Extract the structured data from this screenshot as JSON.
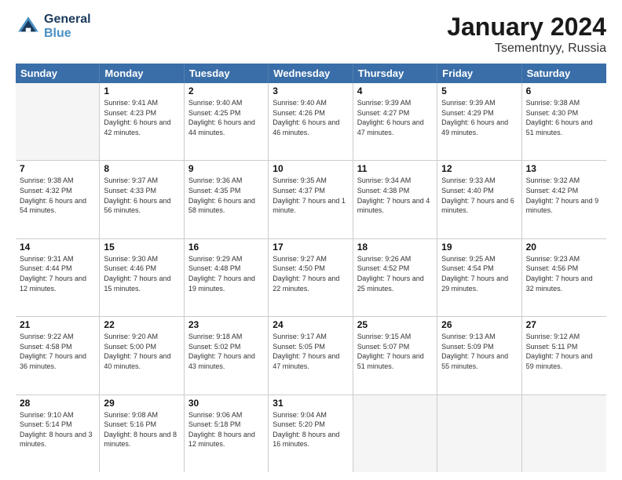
{
  "header": {
    "logo_line1": "General",
    "logo_line2": "Blue",
    "month_title": "January 2024",
    "location": "Tsementnyy, Russia"
  },
  "days_of_week": [
    "Sunday",
    "Monday",
    "Tuesday",
    "Wednesday",
    "Thursday",
    "Friday",
    "Saturday"
  ],
  "weeks": [
    [
      {
        "day": "",
        "empty": true
      },
      {
        "day": "1",
        "sunrise": "Sunrise: 9:41 AM",
        "sunset": "Sunset: 4:23 PM",
        "daylight": "Daylight: 6 hours and 42 minutes."
      },
      {
        "day": "2",
        "sunrise": "Sunrise: 9:40 AM",
        "sunset": "Sunset: 4:25 PM",
        "daylight": "Daylight: 6 hours and 44 minutes."
      },
      {
        "day": "3",
        "sunrise": "Sunrise: 9:40 AM",
        "sunset": "Sunset: 4:26 PM",
        "daylight": "Daylight: 6 hours and 46 minutes."
      },
      {
        "day": "4",
        "sunrise": "Sunrise: 9:39 AM",
        "sunset": "Sunset: 4:27 PM",
        "daylight": "Daylight: 6 hours and 47 minutes."
      },
      {
        "day": "5",
        "sunrise": "Sunrise: 9:39 AM",
        "sunset": "Sunset: 4:29 PM",
        "daylight": "Daylight: 6 hours and 49 minutes."
      },
      {
        "day": "6",
        "sunrise": "Sunrise: 9:38 AM",
        "sunset": "Sunset: 4:30 PM",
        "daylight": "Daylight: 6 hours and 51 minutes."
      }
    ],
    [
      {
        "day": "7",
        "sunrise": "Sunrise: 9:38 AM",
        "sunset": "Sunset: 4:32 PM",
        "daylight": "Daylight: 6 hours and 54 minutes."
      },
      {
        "day": "8",
        "sunrise": "Sunrise: 9:37 AM",
        "sunset": "Sunset: 4:33 PM",
        "daylight": "Daylight: 6 hours and 56 minutes."
      },
      {
        "day": "9",
        "sunrise": "Sunrise: 9:36 AM",
        "sunset": "Sunset: 4:35 PM",
        "daylight": "Daylight: 6 hours and 58 minutes."
      },
      {
        "day": "10",
        "sunrise": "Sunrise: 9:35 AM",
        "sunset": "Sunset: 4:37 PM",
        "daylight": "Daylight: 7 hours and 1 minute."
      },
      {
        "day": "11",
        "sunrise": "Sunrise: 9:34 AM",
        "sunset": "Sunset: 4:38 PM",
        "daylight": "Daylight: 7 hours and 4 minutes."
      },
      {
        "day": "12",
        "sunrise": "Sunrise: 9:33 AM",
        "sunset": "Sunset: 4:40 PM",
        "daylight": "Daylight: 7 hours and 6 minutes."
      },
      {
        "day": "13",
        "sunrise": "Sunrise: 9:32 AM",
        "sunset": "Sunset: 4:42 PM",
        "daylight": "Daylight: 7 hours and 9 minutes."
      }
    ],
    [
      {
        "day": "14",
        "sunrise": "Sunrise: 9:31 AM",
        "sunset": "Sunset: 4:44 PM",
        "daylight": "Daylight: 7 hours and 12 minutes."
      },
      {
        "day": "15",
        "sunrise": "Sunrise: 9:30 AM",
        "sunset": "Sunset: 4:46 PM",
        "daylight": "Daylight: 7 hours and 15 minutes."
      },
      {
        "day": "16",
        "sunrise": "Sunrise: 9:29 AM",
        "sunset": "Sunset: 4:48 PM",
        "daylight": "Daylight: 7 hours and 19 minutes."
      },
      {
        "day": "17",
        "sunrise": "Sunrise: 9:27 AM",
        "sunset": "Sunset: 4:50 PM",
        "daylight": "Daylight: 7 hours and 22 minutes."
      },
      {
        "day": "18",
        "sunrise": "Sunrise: 9:26 AM",
        "sunset": "Sunset: 4:52 PM",
        "daylight": "Daylight: 7 hours and 25 minutes."
      },
      {
        "day": "19",
        "sunrise": "Sunrise: 9:25 AM",
        "sunset": "Sunset: 4:54 PM",
        "daylight": "Daylight: 7 hours and 29 minutes."
      },
      {
        "day": "20",
        "sunrise": "Sunrise: 9:23 AM",
        "sunset": "Sunset: 4:56 PM",
        "daylight": "Daylight: 7 hours and 32 minutes."
      }
    ],
    [
      {
        "day": "21",
        "sunrise": "Sunrise: 9:22 AM",
        "sunset": "Sunset: 4:58 PM",
        "daylight": "Daylight: 7 hours and 36 minutes."
      },
      {
        "day": "22",
        "sunrise": "Sunrise: 9:20 AM",
        "sunset": "Sunset: 5:00 PM",
        "daylight": "Daylight: 7 hours and 40 minutes."
      },
      {
        "day": "23",
        "sunrise": "Sunrise: 9:18 AM",
        "sunset": "Sunset: 5:02 PM",
        "daylight": "Daylight: 7 hours and 43 minutes."
      },
      {
        "day": "24",
        "sunrise": "Sunrise: 9:17 AM",
        "sunset": "Sunset: 5:05 PM",
        "daylight": "Daylight: 7 hours and 47 minutes."
      },
      {
        "day": "25",
        "sunrise": "Sunrise: 9:15 AM",
        "sunset": "Sunset: 5:07 PM",
        "daylight": "Daylight: 7 hours and 51 minutes."
      },
      {
        "day": "26",
        "sunrise": "Sunrise: 9:13 AM",
        "sunset": "Sunset: 5:09 PM",
        "daylight": "Daylight: 7 hours and 55 minutes."
      },
      {
        "day": "27",
        "sunrise": "Sunrise: 9:12 AM",
        "sunset": "Sunset: 5:11 PM",
        "daylight": "Daylight: 7 hours and 59 minutes."
      }
    ],
    [
      {
        "day": "28",
        "sunrise": "Sunrise: 9:10 AM",
        "sunset": "Sunset: 5:14 PM",
        "daylight": "Daylight: 8 hours and 3 minutes."
      },
      {
        "day": "29",
        "sunrise": "Sunrise: 9:08 AM",
        "sunset": "Sunset: 5:16 PM",
        "daylight": "Daylight: 8 hours and 8 minutes."
      },
      {
        "day": "30",
        "sunrise": "Sunrise: 9:06 AM",
        "sunset": "Sunset: 5:18 PM",
        "daylight": "Daylight: 8 hours and 12 minutes."
      },
      {
        "day": "31",
        "sunrise": "Sunrise: 9:04 AM",
        "sunset": "Sunset: 5:20 PM",
        "daylight": "Daylight: 8 hours and 16 minutes."
      },
      {
        "day": "",
        "empty": true
      },
      {
        "day": "",
        "empty": true
      },
      {
        "day": "",
        "empty": true
      }
    ]
  ]
}
